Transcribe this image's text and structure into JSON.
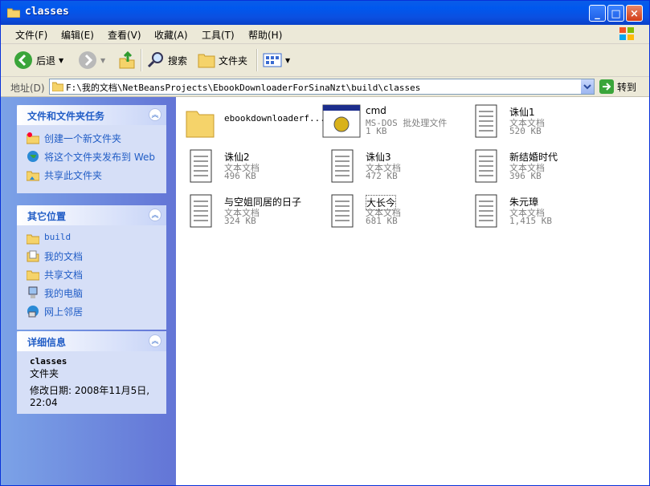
{
  "window": {
    "title": "classes"
  },
  "menu": [
    {
      "label": "文件(F)"
    },
    {
      "label": "编辑(E)"
    },
    {
      "label": "查看(V)"
    },
    {
      "label": "收藏(A)"
    },
    {
      "label": "工具(T)"
    },
    {
      "label": "帮助(H)"
    }
  ],
  "toolbar": {
    "back": "后退",
    "search": "搜索",
    "folders": "文件夹"
  },
  "address": {
    "label": "地址(D)",
    "value": "F:\\我的文档\\NetBeansProjects\\EbookDownloaderForSinaNzt\\build\\classes",
    "go": "转到"
  },
  "panels": {
    "tasks": {
      "title": "文件和文件夹任务",
      "items": [
        "创建一个新文件夹",
        "将这个文件夹发布到 Web",
        "共享此文件夹"
      ]
    },
    "places": {
      "title": "其它位置",
      "items": [
        "build",
        "我的文档",
        "共享文档",
        "我的电脑",
        "网上邻居"
      ]
    },
    "details": {
      "title": "详细信息",
      "name": "classes",
      "type": "文件夹",
      "modified": "修改日期: 2008年11月5日, 22:04"
    }
  },
  "files": [
    {
      "name": "ebookdownloaderf...",
      "type": "",
      "size": "",
      "icon": "folder-icon"
    },
    {
      "name": "cmd",
      "type": "MS-DOS 批处理文件",
      "size": "1 KB",
      "icon": "batch-file-icon"
    },
    {
      "name": "诛仙1",
      "type": "文本文档",
      "size": "520 KB",
      "icon": "text-file-icon"
    },
    {
      "name": "诛仙2",
      "type": "文本文档",
      "size": "496 KB",
      "icon": "text-file-icon"
    },
    {
      "name": "诛仙3",
      "type": "文本文档",
      "size": "472 KB",
      "icon": "text-file-icon"
    },
    {
      "name": "新结婚时代",
      "type": "文本文档",
      "size": "396 KB",
      "icon": "text-file-icon"
    },
    {
      "name": "与空姐同居的日子",
      "type": "文本文档",
      "size": "324 KB",
      "icon": "text-file-icon"
    },
    {
      "name": "大长今",
      "type": "文本文档",
      "size": "681 KB",
      "icon": "text-file-icon"
    },
    {
      "name": "朱元璋",
      "type": "文本文档",
      "size": "1,415 KB",
      "icon": "text-file-icon"
    }
  ]
}
